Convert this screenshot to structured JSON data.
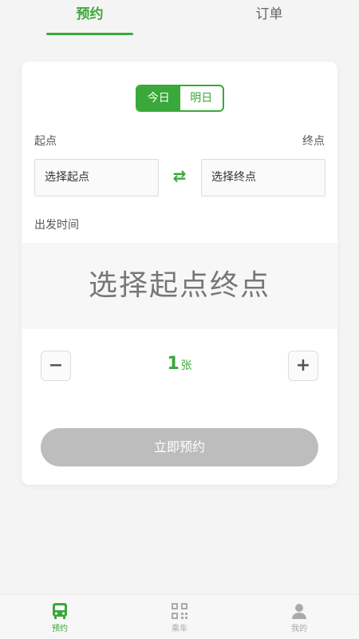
{
  "tabs": [
    {
      "label": "预约",
      "active": true
    },
    {
      "label": "订单",
      "active": false
    }
  ],
  "day_toggle": {
    "today": "今日",
    "tomorrow": "明日",
    "selected": "today"
  },
  "route": {
    "from_label": "起点",
    "to_label": "终点",
    "from_placeholder": "选择起点",
    "to_placeholder": "选择终点",
    "swap_icon": "swap-icon"
  },
  "departure": {
    "label": "出发时间",
    "placeholder": "选择起点终点"
  },
  "ticket": {
    "minus": "−",
    "plus": "+",
    "count": "1",
    "unit": "张"
  },
  "submit_label": "立即预约",
  "bottom_nav": [
    {
      "label": "预约",
      "icon": "bus-icon",
      "active": true
    },
    {
      "label": "乘车",
      "icon": "qr-code-icon",
      "active": false
    },
    {
      "label": "我的",
      "icon": "user-icon",
      "active": false
    }
  ],
  "colors": {
    "accent": "#3aa83a",
    "disabled_button": "#bdbdbd"
  }
}
